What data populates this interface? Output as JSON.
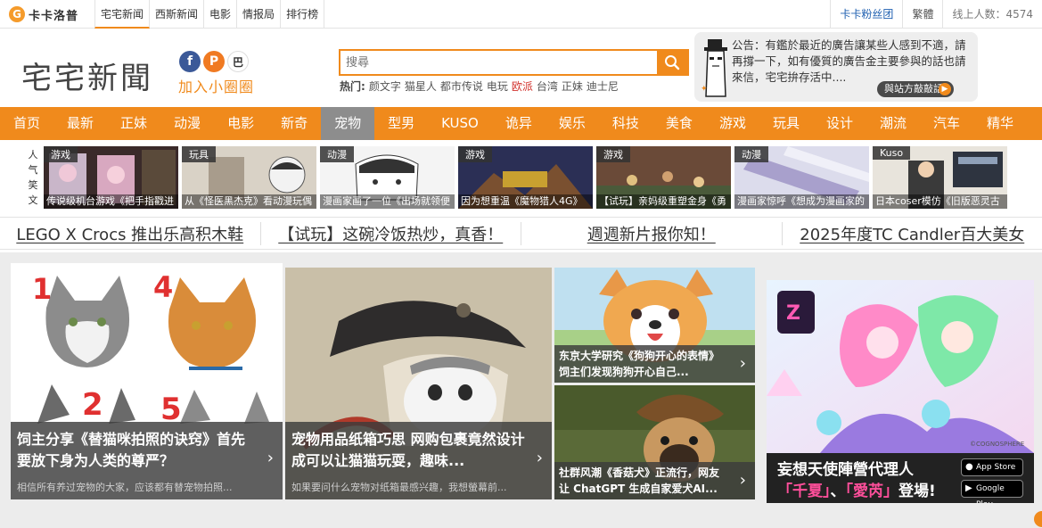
{
  "brand": {
    "logo_letter": "G",
    "name": "卡卡洛普"
  },
  "top_nav": [
    "宅宅新闻",
    "西斯新闻",
    "电影",
    "情报局",
    "排行榜"
  ],
  "top_right": {
    "fans": "卡卡粉丝团",
    "lang": "繁體",
    "online": "线上人数：4574"
  },
  "header": {
    "logo_text": "宅宅新聞",
    "social_fb": "f",
    "social_plurk": "P",
    "social_bahamut": "巴",
    "join_text": "加入小圈圈"
  },
  "search": {
    "placeholder": "搜尋"
  },
  "hot": {
    "label": "热门:",
    "items": [
      "颜文字",
      "猫星人",
      "都市传说",
      "电玩",
      "欧派",
      "台湾",
      "正妹",
      "迪士尼"
    ]
  },
  "notice": {
    "text": "公告：有鑑於最近的廣告讓某些人感到不適，請再撐一下，如有優質的廣告金主要參與的話也請來信，宅宅拚存活中....",
    "button": "與站方敲敲話",
    "arrow": "▶"
  },
  "main_nav": [
    "首页",
    "最新",
    "正妹",
    "动漫",
    "电影",
    "新奇",
    "宠物",
    "型男",
    "KUSO",
    "诡异",
    "娱乐",
    "科技",
    "美食",
    "游戏",
    "玩具",
    "设计",
    "潮流",
    "汽车",
    "精华"
  ],
  "popular": {
    "label": [
      "人",
      "气",
      "笑",
      "文"
    ],
    "items": [
      {
        "tag": "游戏",
        "caption": "传说级机台游戏《把手指戳进"
      },
      {
        "tag": "玩具",
        "caption": "从《怪医黑杰克》看动漫玩偶"
      },
      {
        "tag": "动漫",
        "caption": "漫画家画了一位《出场就领便"
      },
      {
        "tag": "游戏",
        "caption": "因为想重温《魔物猎人4G》"
      },
      {
        "tag": "游戏",
        "caption": "【试玩】亲妈级重塑金身《勇"
      },
      {
        "tag": "动漫",
        "caption": "漫画家惊呼《想成为漫画家的"
      },
      {
        "tag": "Kuso",
        "caption": "日本coser模仿《旧版恶灵古"
      }
    ]
  },
  "headlines": [
    "LEGO X Crocs 推出乐高积木鞋",
    "【试玩】这碗冷饭热炒，真香！",
    "週週新片报你知！",
    "2025年度TC Candler百大美女"
  ],
  "featured": {
    "card1": {
      "title": "饲主分享《替猫咪拍照的诀窍》首先要放下身为人类的尊严？",
      "desc": "相信所有养过宠物的大家，应该都有替宠物拍照..."
    },
    "card2": {
      "title": "宠物用品纸箱巧思 网购包裹竟然设计成可以让猫猫玩耍，趣味...",
      "desc": "如果要问什么宠物对纸箱最感兴趣，我想螢幕前..."
    },
    "card3": {
      "title": "东京大学研究《狗狗开心的表情》饲主们发现狗狗开心自己..."
    },
    "card4": {
      "title": "社群风潮《香菇犬》正流行，网友让 ChatGPT 生成自家爱犬AI..."
    }
  },
  "ad": {
    "line1": "妄想天使陣營代理人",
    "line2_a": "「千夏」",
    "line2_sep": "、",
    "line2_b": "「愛芮」",
    "line2_c": "登場!",
    "appstore": "App Store",
    "googleplay": "Google Play",
    "copyright": "©COGNOSPHERE"
  },
  "colors": {
    "accent": "#f08a1c",
    "nav_active": "#8d8d8d",
    "link_blue": "#1e5fb0",
    "hot_red": "#d2322d"
  }
}
